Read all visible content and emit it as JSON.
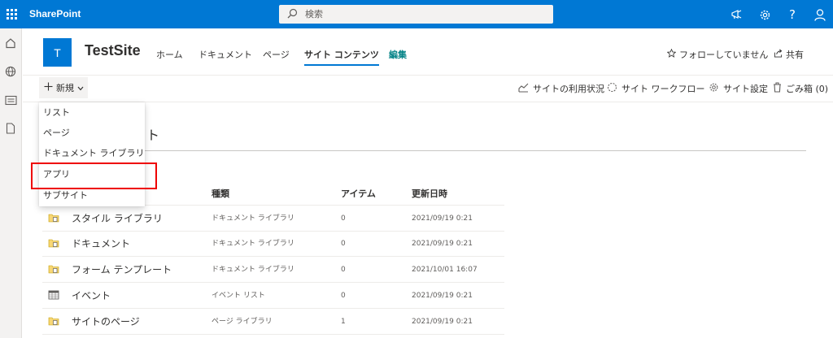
{
  "suite_bar": {
    "brand": "SharePoint",
    "search_placeholder": "検索",
    "icons": [
      "waffle-icon",
      "megaphone-icon",
      "gear-icon",
      "help-icon",
      "person-icon"
    ],
    "help_glyph": "?"
  },
  "left_rail": {
    "icons": [
      "home-icon",
      "globe-icon",
      "news-icon",
      "document-icon"
    ]
  },
  "site": {
    "logo_letter": "T",
    "title": "TestSite",
    "nav": [
      "ホーム",
      "ドキュメント",
      "ページ",
      "サイト コンテンツ",
      "編集"
    ],
    "active_nav": "サイト コンテンツ",
    "follow_label": "フォローしていません",
    "share_label": "共有"
  },
  "command_bar": {
    "new_label": "新規",
    "site_usage": "サイトの利用状況",
    "site_workflow": "サイト ワークフロー",
    "site_settings": "サイト設定",
    "recycle_bin": "ごみ箱 (0)"
  },
  "new_menu": {
    "items": [
      "リスト",
      "ページ",
      "ドキュメント ライブラリ",
      "アプリ",
      "サブサイト"
    ],
    "highlighted": "アプリ"
  },
  "page": {
    "heading_visible_fragment": "ト"
  },
  "table": {
    "headers": [
      "種類",
      "アイテム",
      "更新日時"
    ],
    "rows": [
      {
        "name": "スタイル ライブラリ",
        "type": "ドキュメント ライブラリ",
        "count": "0",
        "modified": "2021/09/19 0:21",
        "icon": "library-icon"
      },
      {
        "name": "ドキュメント",
        "type": "ドキュメント ライブラリ",
        "count": "0",
        "modified": "2021/09/19 0:21",
        "icon": "library-icon"
      },
      {
        "name": "フォーム テンプレート",
        "type": "ドキュメント ライブラリ",
        "count": "0",
        "modified": "2021/10/01 16:07",
        "icon": "library-icon"
      },
      {
        "name": "イベント",
        "type": "イベント リスト",
        "count": "0",
        "modified": "2021/09/19 0:21",
        "icon": "calendar-icon"
      },
      {
        "name": "サイトのページ",
        "type": "ページ ライブラリ",
        "count": "1",
        "modified": "2021/09/19 0:21",
        "icon": "library-icon"
      }
    ]
  },
  "colors": {
    "suite_bar": "#0078d4",
    "accent": "#0078d4",
    "edit_link": "#038387",
    "highlight_box": "#ee0000"
  }
}
